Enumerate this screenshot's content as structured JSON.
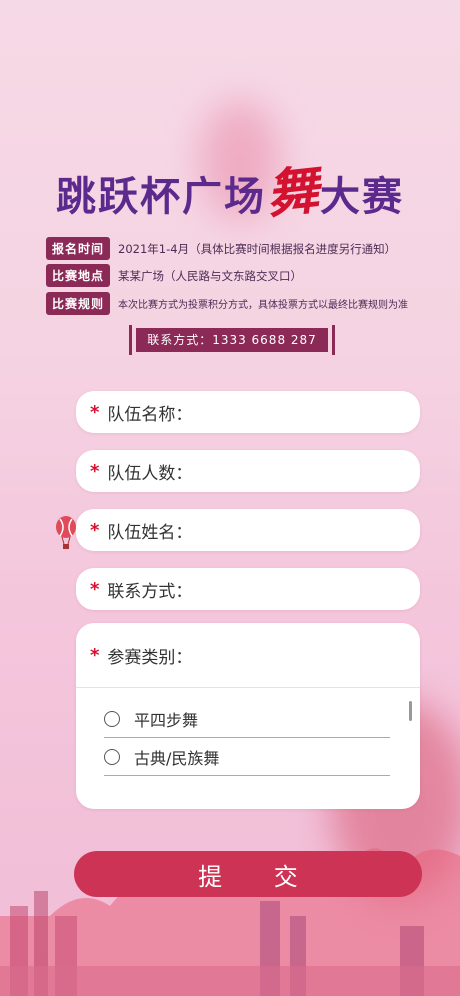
{
  "title": {
    "part1": "跳跃杯广场",
    "dance": "舞",
    "part2": "大赛"
  },
  "info": [
    {
      "tag": "报名时间",
      "text": "2021年1-4月（具体比赛时间根据报名进度另行通知）"
    },
    {
      "tag": "比赛地点",
      "text": "某某广场（人民路与文东路交叉口）"
    },
    {
      "tag": "比赛规则",
      "text": "本次比赛方式为投票积分方式，具体投票方式以最终比赛规则为准"
    }
  ],
  "contact": "联系方式：1333 6688 287",
  "form": {
    "team_name": "队伍名称：",
    "team_count": "队伍人数：",
    "team_member": "队伍姓名：",
    "phone": "联系方式：",
    "category": "参赛类别：",
    "options": [
      "平四步舞",
      "古典/民族舞"
    ],
    "required_mark": "*"
  },
  "submit": "提 交",
  "colors": {
    "accent": "#8c2a57",
    "required": "#d3122f",
    "submit": "#cc3355",
    "title": "#5b2a8c"
  }
}
